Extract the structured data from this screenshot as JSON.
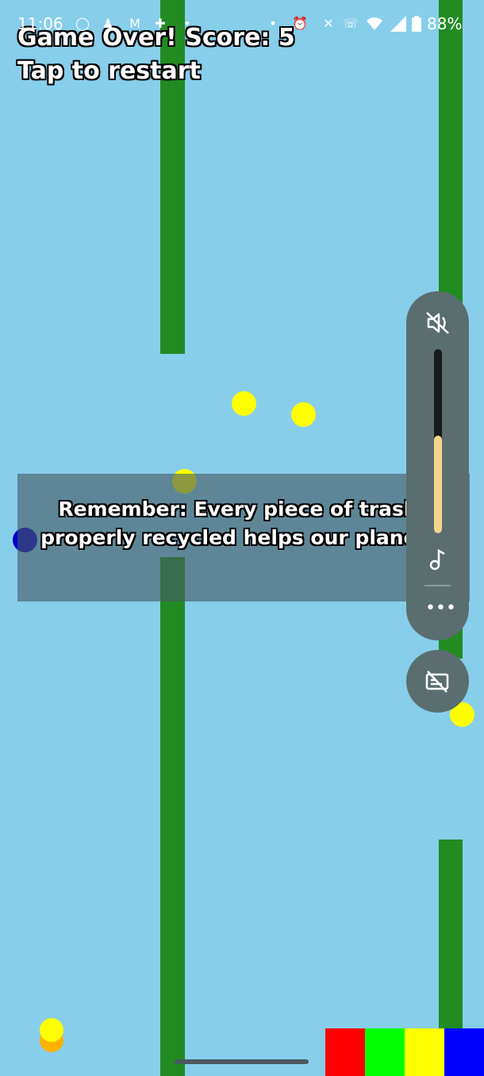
{
  "status_bar": {
    "time": "11:06",
    "battery": "88%",
    "left_icons": [
      "whatsapp-icon",
      "snapchat-icon",
      "gmail-icon",
      "game-icon",
      "dot-icon"
    ],
    "right_icons": [
      "alarm-icon",
      "mute-icon",
      "wifi-call-icon",
      "wifi-icon",
      "signal-icon",
      "battery-icon"
    ]
  },
  "game": {
    "game_over": "Game Over! Score: 5",
    "restart": "Tap to restart",
    "message": "Remember: Every piece of trash properly recycled helps our planet!",
    "colors": {
      "pipe": "#228B22",
      "sky": "#87CEEB",
      "coin": "#FFFF00",
      "player": "#0000CD",
      "bin_red": "#FF0000",
      "bin_green": "#00FF00",
      "bin_yellow": "#FFFF00",
      "bin_blue": "#0000FF"
    }
  },
  "volume_panel": {
    "level_percent": 53,
    "icons": [
      "volume-off-icon",
      "music-note-icon",
      "more-icon",
      "captions-off-icon"
    ]
  }
}
